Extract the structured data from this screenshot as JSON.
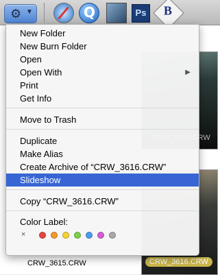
{
  "toolbar": {
    "action_icon": "gear-icon",
    "app_icons": [
      "safari-icon",
      "quicktime-icon",
      "preview-icon",
      "photoshop-icon",
      "bbedit-icon"
    ],
    "photoshop_glyph": "Ps",
    "bbedit_glyph": "B"
  },
  "files": {
    "top_thumb_label": "CRW_3615.CRW",
    "bottom_left_label": "CRW_3615.CRW",
    "bottom_right_label": "CRW_3616.CRW"
  },
  "menu": {
    "groups": [
      [
        "New Folder",
        "New Burn Folder",
        "Open",
        "Open With",
        "Print",
        "Get Info"
      ],
      [
        "Move to Trash"
      ],
      [
        "Duplicate",
        "Make Alias",
        "Create Archive of “CRW_3616.CRW”",
        "Slideshow"
      ],
      [
        "Copy “CRW_3616.CRW”"
      ]
    ],
    "highlighted": "Slideshow",
    "color_label_heading": "Color Label:",
    "color_none_glyph": "×",
    "colors": [
      "#e8453c",
      "#f39a2b",
      "#f4d232",
      "#7bd04a",
      "#4d9bf0",
      "#d65dd6",
      "#a8a8a8"
    ]
  }
}
